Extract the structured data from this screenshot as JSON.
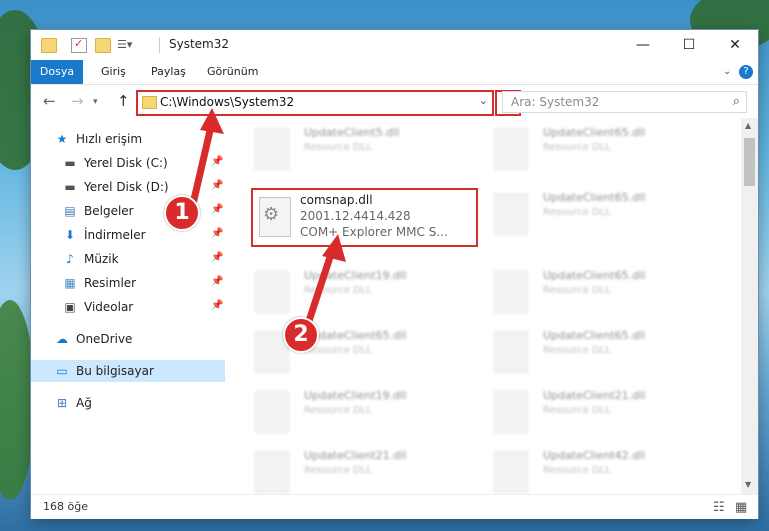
{
  "window": {
    "title": "System32",
    "controls": {
      "minimize": "—",
      "maximize": "☐",
      "close": "✕"
    }
  },
  "ribbon": {
    "tabs": [
      "Dosya",
      "Giriş",
      "Paylaş",
      "Görünüm"
    ],
    "help_icon": "?"
  },
  "nav": {
    "back": "←",
    "forward": "→",
    "up": "↑",
    "address": "C:\\Windows\\System32",
    "refresh": "↻",
    "search_placeholder": "Ara: System32"
  },
  "sidebar": {
    "items": [
      {
        "label": "Hızlı erişim",
        "icon": "star-icon",
        "glyph": "★",
        "color": "#1979ca"
      },
      {
        "label": "Yerel Disk (C:)",
        "icon": "drive-icon",
        "glyph": "▬",
        "color": "#555"
      },
      {
        "label": "Yerel Disk (D:)",
        "icon": "drive-icon",
        "glyph": "▬",
        "color": "#555"
      },
      {
        "label": "Belgeler",
        "icon": "document-icon",
        "glyph": "▤",
        "color": "#3b78b5"
      },
      {
        "label": "İndirmeler",
        "icon": "download-icon",
        "glyph": "⬇",
        "color": "#1979ca"
      },
      {
        "label": "Müzik",
        "icon": "music-icon",
        "glyph": "♪",
        "color": "#1979ca"
      },
      {
        "label": "Resimler",
        "icon": "picture-icon",
        "glyph": "▦",
        "color": "#4a8ac0"
      },
      {
        "label": "Videolar",
        "icon": "video-icon",
        "glyph": "▣",
        "color": "#444"
      },
      {
        "label": "OneDrive",
        "icon": "cloud-icon",
        "glyph": "☁",
        "color": "#1979ca"
      },
      {
        "label": "Bu bilgisayar",
        "icon": "computer-icon",
        "glyph": "▭",
        "color": "#1979ca"
      },
      {
        "label": "Ağ",
        "icon": "network-icon",
        "glyph": "⊞",
        "color": "#3a7cc2"
      }
    ]
  },
  "content": {
    "focused_file": {
      "name": "comsnap.dll",
      "version": "2001.12.4414.428",
      "description": "COM+ Explorer MMC S..."
    },
    "blurred_files": [
      {
        "name": "UpdateClient5.dll",
        "type": "Resource DLL"
      },
      {
        "name": "UpdateClient65.dll",
        "type": "Resource DLL"
      },
      {
        "name": "UpdateClient65.dll",
        "type": "Resource DLL"
      },
      {
        "name": "UpdateClient19.dll",
        "type": "Resource DLL"
      },
      {
        "name": "UpdateClient65.dll",
        "type": "Resource DLL"
      },
      {
        "name": "UpdateClient65.dll",
        "type": "Resource DLL"
      },
      {
        "name": "UpdateClient65.dll",
        "type": "Resource DLL"
      },
      {
        "name": "UpdateClient19.dll",
        "type": "Resource DLL"
      },
      {
        "name": "UpdateClient21.dll",
        "type": "Resource DLL"
      },
      {
        "name": "UpdateClient21.dll",
        "type": "Resource DLL"
      },
      {
        "name": "UpdateClient42.dll",
        "type": "Resource DLL"
      }
    ]
  },
  "status": {
    "item_count": "168 öğe"
  },
  "annotations": {
    "step1": "1",
    "step2": "2",
    "accent": "#d92b2b"
  }
}
